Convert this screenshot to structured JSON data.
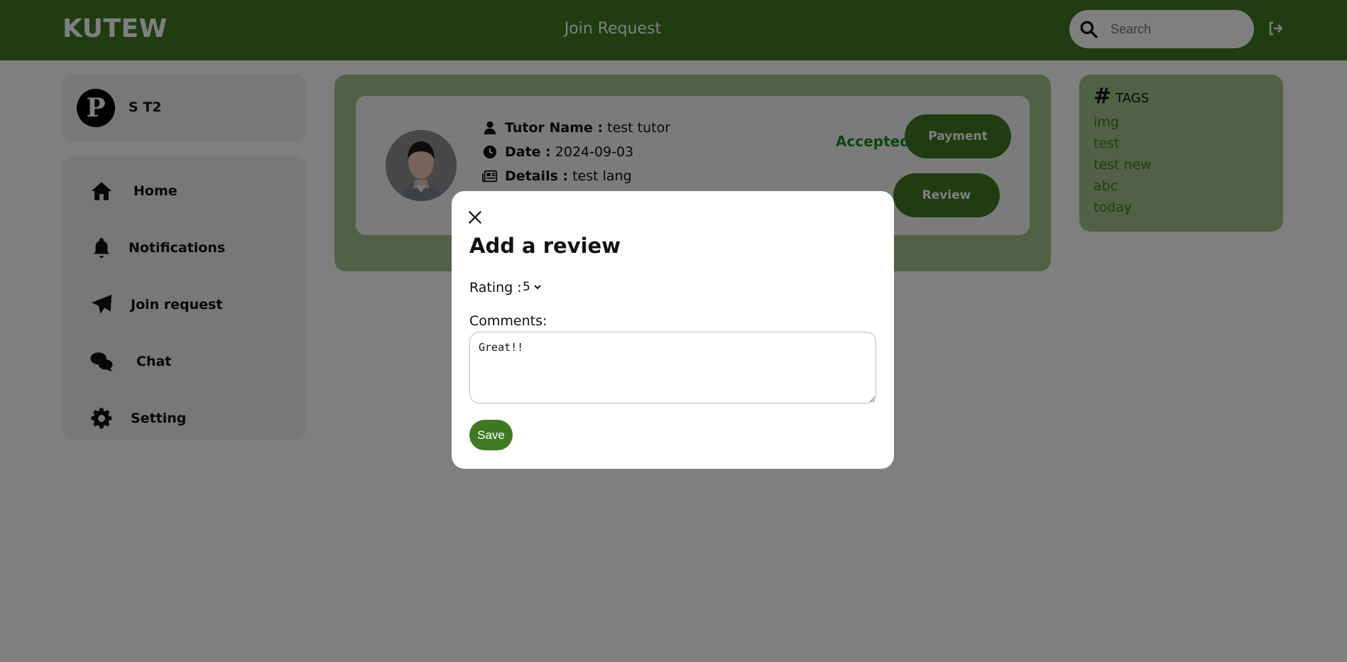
{
  "header": {
    "brand": "KUTEW",
    "title": "Join Request",
    "search_placeholder": "Search"
  },
  "profile": {
    "avatar_letter": "P",
    "name": "S T2"
  },
  "sidebar": {
    "items": [
      {
        "label": "Home",
        "icon": "home-icon"
      },
      {
        "label": "Notifications",
        "icon": "bell-icon"
      },
      {
        "label": "Join request",
        "icon": "paper-plane-icon"
      },
      {
        "label": "Chat",
        "icon": "chat-bubbles-icon"
      },
      {
        "label": "Setting",
        "icon": "gear-icon"
      }
    ]
  },
  "request": {
    "tutor_label": "Tutor Name :",
    "tutor_value": "test tutor",
    "date_label": "Date :",
    "date_value": "2024-09-03",
    "details_label": "Details :",
    "details_value": "test lang",
    "status": "Accepted",
    "payment_label": "Payment",
    "review_label": "Review"
  },
  "tags": {
    "heading": "TAGS",
    "items": [
      "img",
      "test",
      "test new",
      "abc",
      "today"
    ]
  },
  "modal": {
    "title": "Add a review",
    "rating_label": "Rating :",
    "rating_value": "5",
    "comments_label": "Comments:",
    "comments_value": "Great!!",
    "save_label": "Save"
  },
  "colors": {
    "brand_green": "#3f7a22",
    "panel_green": "#a3c28a",
    "status_green": "#1e8a1e",
    "overlay": "rgba(0,0,0,0.5)"
  }
}
